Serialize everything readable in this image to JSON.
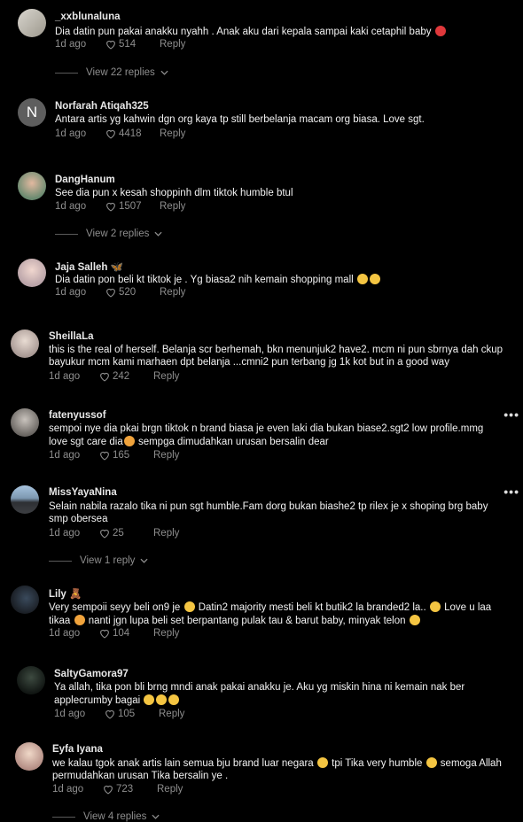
{
  "colors": {
    "background": "#000000",
    "text": "#f2f2f2",
    "muted": "#8e8e8e",
    "username": "#e8e8e8"
  },
  "comments": [
    {
      "username": "_xxblunaluna",
      "text": "Dia datin pun pakai anakku nyahh . Anak aku dari kepala sampai kaki cetaphil baby",
      "age": "1d ago",
      "likes": "514",
      "reply": "Reply",
      "view_replies": "View 22 replies"
    },
    {
      "username": "Norfarah Atiqah325",
      "avatar_letter": "N",
      "text": "Antara artis yg kahwin dgn org kaya tp still berbelanja macam org biasa. Love sgt.",
      "age": "1d ago",
      "likes": "4418",
      "reply": "Reply"
    },
    {
      "username": "DangHanum",
      "text": "See dia pun x kesah shoppinh dlm tiktok humble btul",
      "age": "1d ago",
      "likes": "1507",
      "reply": "Reply",
      "view_replies": "View 2 replies"
    },
    {
      "username": "Jaja Salleh",
      "text": "Dia datin pon beli kt tiktok je . Yg biasa2 nih kemain shopping mall",
      "age": "1d ago",
      "likes": "520",
      "reply": "Reply"
    },
    {
      "username": "SheillaLa",
      "text_lines": [
        "this is the real of herself. Belanja scr berhemah, bkn menunjuk2 have2. mcm ni pun sbrnya dah ckup",
        "bayukur mcm kami marhaen dpt belanja ...cmni2 pun terbang jg 1k kot but in a good way"
      ],
      "age": "1d ago",
      "likes": "242",
      "reply": "Reply"
    },
    {
      "username": "fatenyussof",
      "text_lines": [
        "sempoi nye dia pkai brgn tiktok n brand biasa je even laki dia bukan biase2.sgt2 low profile.mmg",
        "love sgt care dia",
        "sempga dimudahkan urusan bersalin dear"
      ],
      "age": "1d ago",
      "likes": "165",
      "reply": "Reply"
    },
    {
      "username": "MissYayaNina",
      "text_lines": [
        "Selain nabila razalo tika ni pun sgt humble.Fam dorg bukan biashe2 tp rilex je x shoping brg baby",
        "smp obersea"
      ],
      "age": "1d ago",
      "likes": "25",
      "reply": "Reply",
      "view_replies": "View 1 reply"
    },
    {
      "username": "Lily",
      "text_lines": [
        "Very sempoii seyy beli on9 je",
        "Datin2 majority mesti beli kt butik2 la branded2 la..",
        "Love u laa",
        "tikaa",
        "nanti jgn lupa beli set berpantang pulak tau & barut baby, minyak telon"
      ],
      "age": "1d ago",
      "likes": "104",
      "reply": "Reply"
    },
    {
      "username": "SaltyGamora97",
      "text_lines": [
        "Ya allah, tika pon bli brng mndi anak pakai anakku je. Aku yg miskin hina ni kemain nak ber",
        "applecrumby bagai"
      ],
      "age": "1d ago",
      "likes": "105",
      "reply": "Reply"
    },
    {
      "username": "Eyfa Iyana",
      "text_lines": [
        "we kalau tgok anak artis lain semua bju brand luar negara",
        "tpi Tika very humble",
        "semoga Allah",
        "permudahkan urusan Tika bersalin ye ."
      ],
      "age": "1d ago",
      "likes": "723",
      "reply": "Reply",
      "view_replies": "View 4 replies"
    }
  ]
}
